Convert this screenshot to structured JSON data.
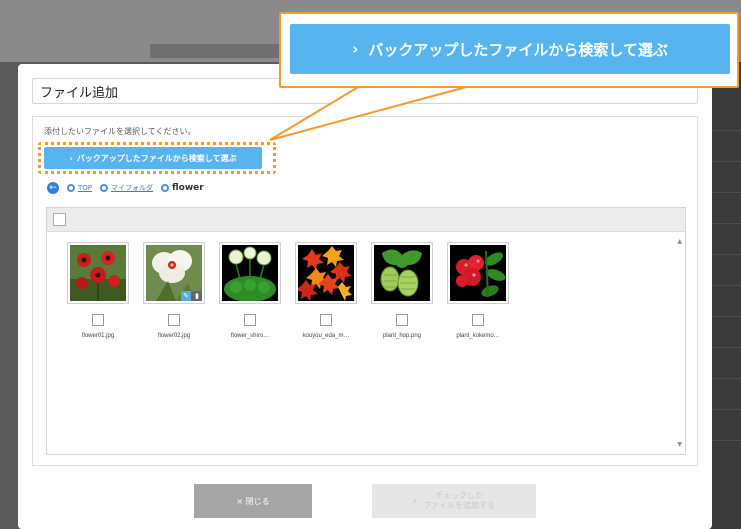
{
  "modal": {
    "title": "ファイル追加",
    "instruction": "添付したいファイルを選択してください。",
    "backup_button_label": "バックアップしたファイルから検索して選ぶ"
  },
  "callout": {
    "button_label": "バックアップしたファイルから検索して選ぶ"
  },
  "breadcrumb": {
    "back_icon": "back-arrow-icon",
    "items": [
      {
        "label": "TOP"
      },
      {
        "label": "マイフォルダ"
      }
    ],
    "current": "flower"
  },
  "files": [
    {
      "name": "flower01.jpg",
      "icon": "red-flowers"
    },
    {
      "name": "flower02.jpg",
      "icon": "white-flower"
    },
    {
      "name": "flower_shiro…",
      "icon": "white-clover-flowers"
    },
    {
      "name": "kouyou_eda_m…",
      "icon": "autumn-leaves"
    },
    {
      "name": "plant_hop.png",
      "icon": "hop-plant"
    },
    {
      "name": "plant_kokemo…",
      "icon": "red-berries"
    }
  ],
  "footer": {
    "close_label": "× 閉じる",
    "add_label_line1": "チェックした",
    "add_label_line2": "ファイルを追加する"
  },
  "colors": {
    "accent_blue": "#57b4ee",
    "highlight_orange": "#f39a2c"
  }
}
